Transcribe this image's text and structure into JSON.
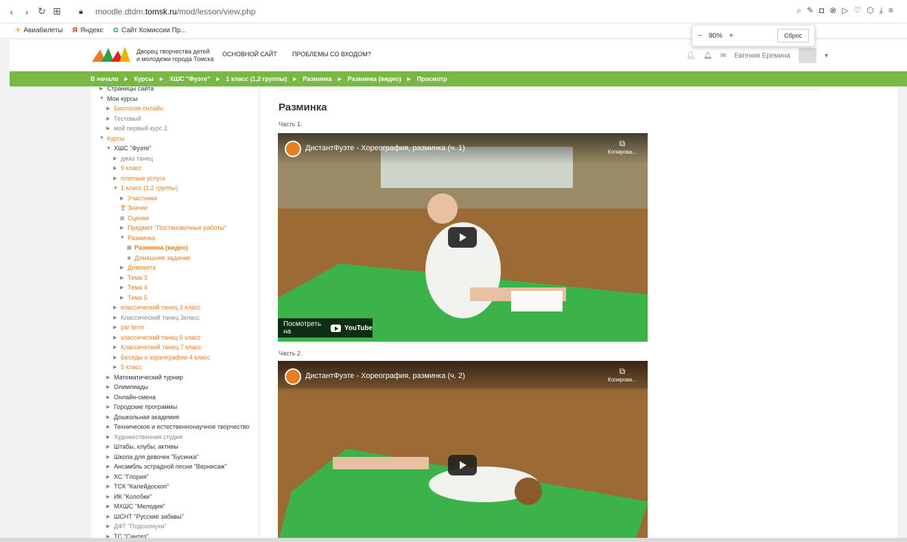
{
  "browser": {
    "url_host": "moodle.dtdm.",
    "url_domain": "tomsk.ru",
    "url_path": "/mod/lesson/view.php",
    "bookmarks": [
      "Авиабилеты",
      "Яндекс",
      "Сайт Комиссии Пр..."
    ]
  },
  "zoom": {
    "minus": "−",
    "value": "90%",
    "plus": "+",
    "reset": "Сброс"
  },
  "header": {
    "org_line1": "Дворец творчества детей",
    "org_line2": "и молодежи города Томска",
    "nav_main": "ОСНОВНОЙ САЙТ",
    "nav_login": "ПРОБЛЕМЫ СО ВХОДОМ?",
    "user_name": "Евгения Еремина",
    "brand_color": "#78b843"
  },
  "breadcrumb": [
    "В начало",
    "Курсы",
    "ХШС \"Фуэте\"",
    "1 класс (1,2 группы)",
    "Разминка",
    "Разминка (видео)",
    "Просмотр"
  ],
  "breadcrumb_sep": "►",
  "sidebar": [
    {
      "label": "Страницы сайта",
      "level": 0,
      "arrow": "▶",
      "style": "dark"
    },
    {
      "label": "Мои курсы",
      "level": 0,
      "arrow": "▼",
      "style": "dark"
    },
    {
      "label": "Биология онлайн",
      "level": 1,
      "arrow": "▶",
      "style": "orange"
    },
    {
      "label": "Тестовый",
      "level": 1,
      "arrow": "▶",
      "style": "gray"
    },
    {
      "label": "мой первый курс 2",
      "level": 1,
      "arrow": "▶",
      "style": "gray"
    },
    {
      "label": "Курсы",
      "level": 0,
      "arrow": "▼",
      "style": "orange"
    },
    {
      "label": "ХШС \"Фуэте\"",
      "level": 1,
      "arrow": "▼",
      "style": "dark"
    },
    {
      "label": "джаз танец",
      "level": 2,
      "arrow": "▶",
      "style": "gray"
    },
    {
      "label": "9 класс",
      "level": 2,
      "arrow": "▶",
      "style": "orange"
    },
    {
      "label": "платные услуги",
      "level": 2,
      "arrow": "▶",
      "style": "orange"
    },
    {
      "label": "1 класс (1,2 группы)",
      "level": 2,
      "arrow": "▼",
      "style": "orange"
    },
    {
      "label": "Участники",
      "level": 3,
      "arrow": "▶",
      "style": "orange"
    },
    {
      "label": "Значки",
      "level": 3,
      "arrow": "🏆",
      "style": "orange"
    },
    {
      "label": "Оценки",
      "level": 3,
      "arrow": "▦",
      "style": "orange"
    },
    {
      "label": "Предмет \"Постановочные работы\"",
      "level": 3,
      "arrow": "▶",
      "style": "orange"
    },
    {
      "label": "Разминка",
      "level": 3,
      "arrow": "▼",
      "style": "orange"
    },
    {
      "label": "Разминка (видео)",
      "level": 4,
      "arrow": "▤",
      "style": "active"
    },
    {
      "label": "Домашнее задание",
      "level": 4,
      "arrow": "◉",
      "style": "orange"
    },
    {
      "label": "Домовята",
      "level": 3,
      "arrow": "▶",
      "style": "orange"
    },
    {
      "label": "Тема 3",
      "level": 3,
      "arrow": "▶",
      "style": "orange"
    },
    {
      "label": "Тема 4",
      "level": 3,
      "arrow": "▶",
      "style": "orange"
    },
    {
      "label": "Тема 5",
      "level": 3,
      "arrow": "▶",
      "style": "orange"
    },
    {
      "label": "классический танец 2 класс",
      "level": 2,
      "arrow": "▶",
      "style": "orange"
    },
    {
      "label": "Классический танец 3класс",
      "level": 2,
      "arrow": "▶",
      "style": "gray"
    },
    {
      "label": "par terre",
      "level": 2,
      "arrow": "▶",
      "style": "orange"
    },
    {
      "label": "классический танец 6 класс",
      "level": 2,
      "arrow": "▶",
      "style": "orange"
    },
    {
      "label": "Классический танец 7 класс",
      "level": 2,
      "arrow": "▶",
      "style": "orange"
    },
    {
      "label": "Беседы о хореографии 4 класс",
      "level": 2,
      "arrow": "▶",
      "style": "orange"
    },
    {
      "label": "5 класс",
      "level": 2,
      "arrow": "▶",
      "style": "orange"
    },
    {
      "label": "Математический турнир",
      "level": 1,
      "arrow": "▶",
      "style": "dark"
    },
    {
      "label": "Олимпиады",
      "level": 1,
      "arrow": "▶",
      "style": "dark"
    },
    {
      "label": "Онлайн-смена",
      "level": 1,
      "arrow": "▶",
      "style": "dark"
    },
    {
      "label": "Городские программы",
      "level": 1,
      "arrow": "▶",
      "style": "dark"
    },
    {
      "label": "Дошкольная академия",
      "level": 1,
      "arrow": "▶",
      "style": "dark"
    },
    {
      "label": "Техническое и естественнонаучное творчество",
      "level": 1,
      "arrow": "▶",
      "style": "dark"
    },
    {
      "label": "Художественная студия",
      "level": 1,
      "arrow": "▶",
      "style": "gray"
    },
    {
      "label": "Штабы, клубы, активы",
      "level": 1,
      "arrow": "▶",
      "style": "dark"
    },
    {
      "label": "Школа для девочек \"Бусинка\"",
      "level": 1,
      "arrow": "▶",
      "style": "dark"
    },
    {
      "label": "Ансамбль эстрадной песни \"Вернисаж\"",
      "level": 1,
      "arrow": "▶",
      "style": "dark"
    },
    {
      "label": "ХС \"Глория\"",
      "level": 1,
      "arrow": "▶",
      "style": "dark"
    },
    {
      "label": "ТСК \"Калейдоскоп\"",
      "level": 1,
      "arrow": "▶",
      "style": "dark"
    },
    {
      "label": "ИК \"Колобки\"",
      "level": 1,
      "arrow": "▶",
      "style": "dark"
    },
    {
      "label": "МХШС \"Мелодия\"",
      "level": 1,
      "arrow": "▶",
      "style": "dark"
    },
    {
      "label": "ШСНТ \"Русские забавы\"",
      "level": 1,
      "arrow": "▶",
      "style": "dark"
    },
    {
      "label": "ДФТ \"Подсолнухи\"",
      "level": 1,
      "arrow": "▶",
      "style": "gray"
    },
    {
      "label": "ТС \"Синтез\"",
      "level": 1,
      "arrow": "▶",
      "style": "dark"
    }
  ],
  "main": {
    "title": "Разминка",
    "part1": "Часть 1.",
    "part2": "Часть 2.",
    "video1_title": "ДистантФуэте - Хореография, разминка (ч. 1)",
    "video2_title": "ДистантФуэте - Хореография, разминка (ч. 2)",
    "copy_label": "Копирова...",
    "watch_on": "Посмотреть на",
    "youtube": "YouTube"
  }
}
